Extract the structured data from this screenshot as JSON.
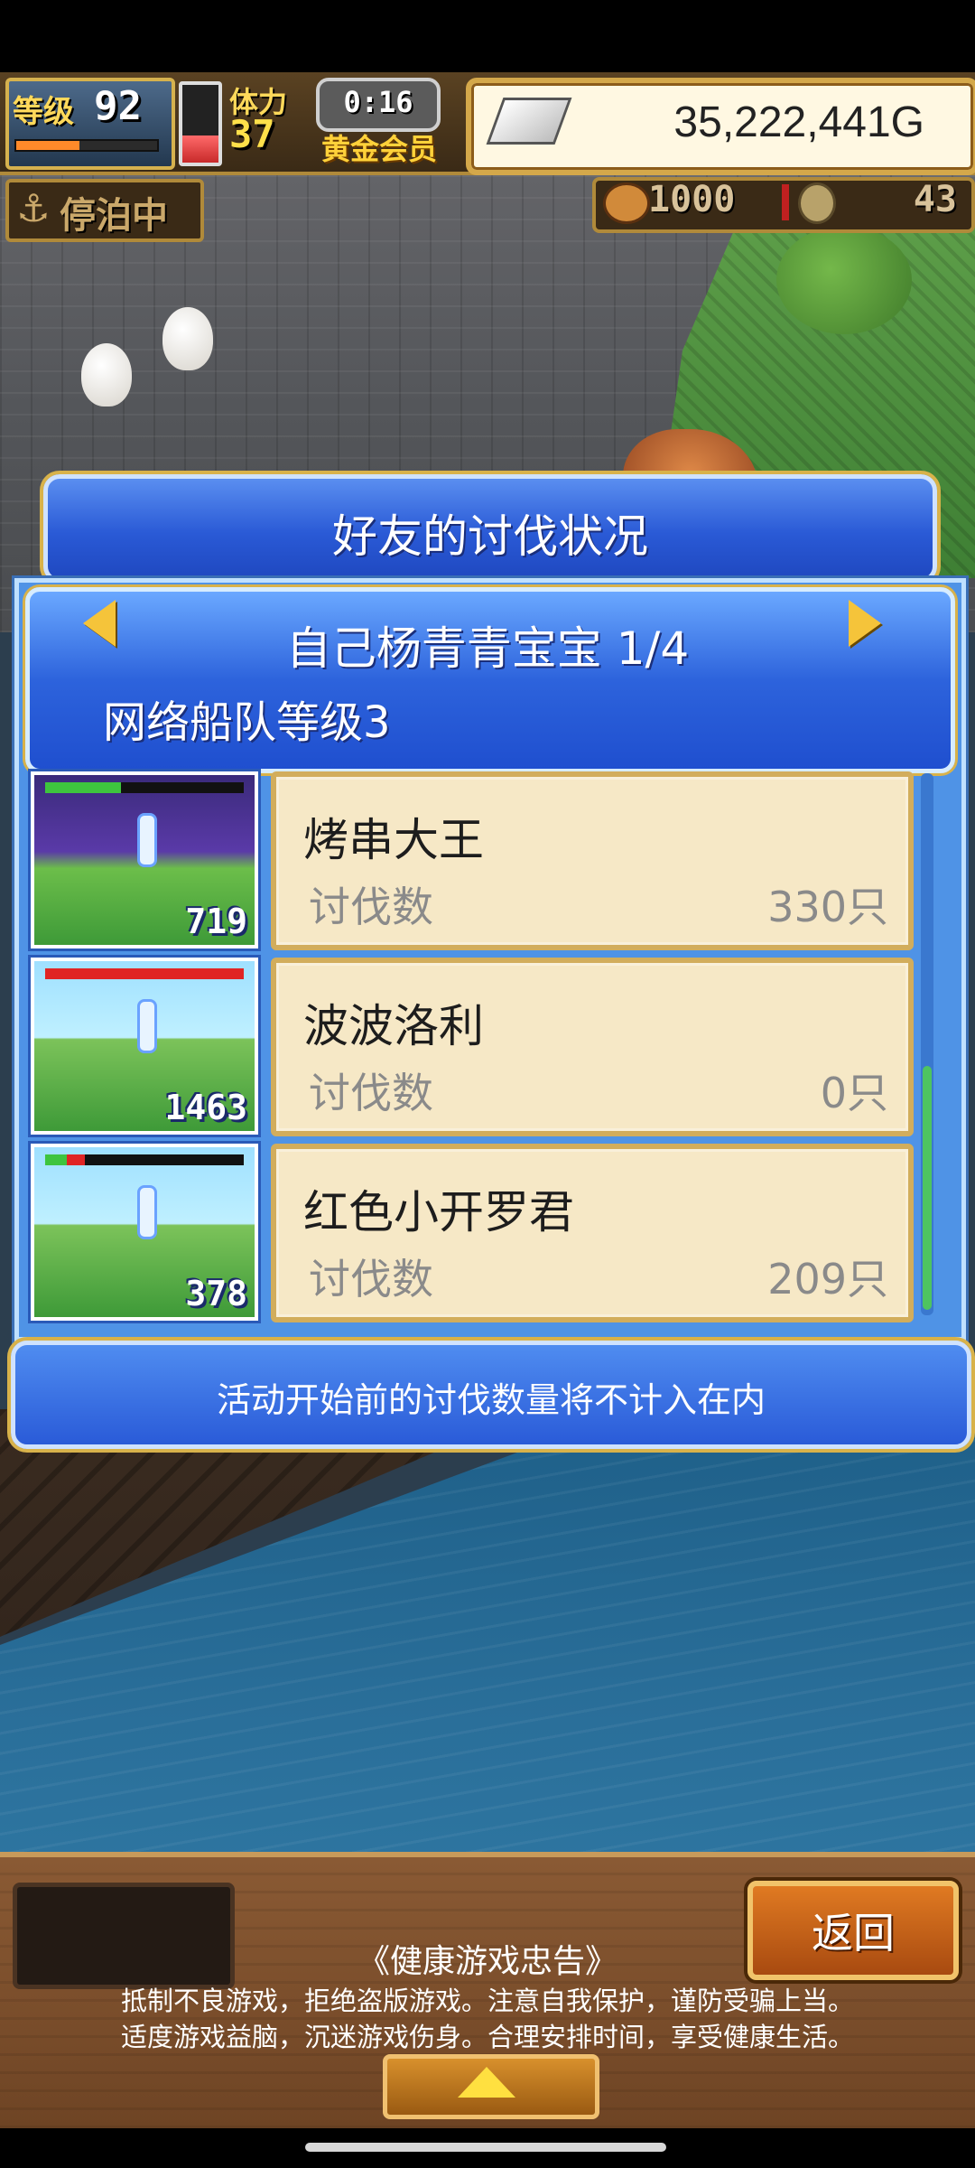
{
  "hud": {
    "level_label": "等级",
    "level_value": "92",
    "exp_fraction": 0.45,
    "stamina_label": "体力",
    "stamina_value": "37",
    "stamina_fraction": 0.35,
    "timer": "0:16",
    "vip_label": "黄金会员",
    "gold_value": "35,222,441G",
    "status_text": "停泊中",
    "resource_1": "1000",
    "resource_2": "43"
  },
  "dialog": {
    "title": "好友的讨伐状况",
    "friend_name": "自己杨青青宝宝 1/4",
    "fleet_level": "网络船队等级3",
    "kill_label": "讨伐数",
    "rows": [
      {
        "monster": "烤串大王",
        "kills": "330只",
        "battle_count": "719",
        "hp_fraction": 0.32,
        "green_fraction": 0.38,
        "theme": "dark"
      },
      {
        "monster": "波波洛利",
        "kills": "0只",
        "battle_count": "1463",
        "hp_fraction": 1.0,
        "green_fraction": 0.0,
        "theme": "light"
      },
      {
        "monster": "红色小开罗君",
        "kills": "209只",
        "battle_count": "378",
        "hp_fraction": 0.2,
        "green_fraction": 0.11,
        "theme": "light"
      }
    ],
    "notice": "活动开始前的讨伐数量将不计入在内"
  },
  "footer": {
    "back_label": "返回",
    "advice_title": "《健康游戏忠告》",
    "advice_line1": "抵制不良游戏，拒绝盗版游戏。注意自我保护，谨防受骗上当。",
    "advice_line2": "适度游戏益脑，沉迷游戏伤身。合理安排时间，享受健康生活。"
  },
  "icons": {
    "gold": "silver-ingot-icon",
    "status": "anchor-icon",
    "resource_1": "meat-icon",
    "resource_2": "medal-icon",
    "nav_left": "arrow-left-icon",
    "nav_right": "arrow-right-icon",
    "expand": "triangle-up-icon"
  },
  "colors": {
    "panel_blue": "#4f93e6",
    "gold_trim": "#d8b24a",
    "card_bg": "#f6e8c6",
    "hp_red": "#e02424",
    "hp_green": "#3ec43e",
    "button_orange": "#e07a22"
  }
}
